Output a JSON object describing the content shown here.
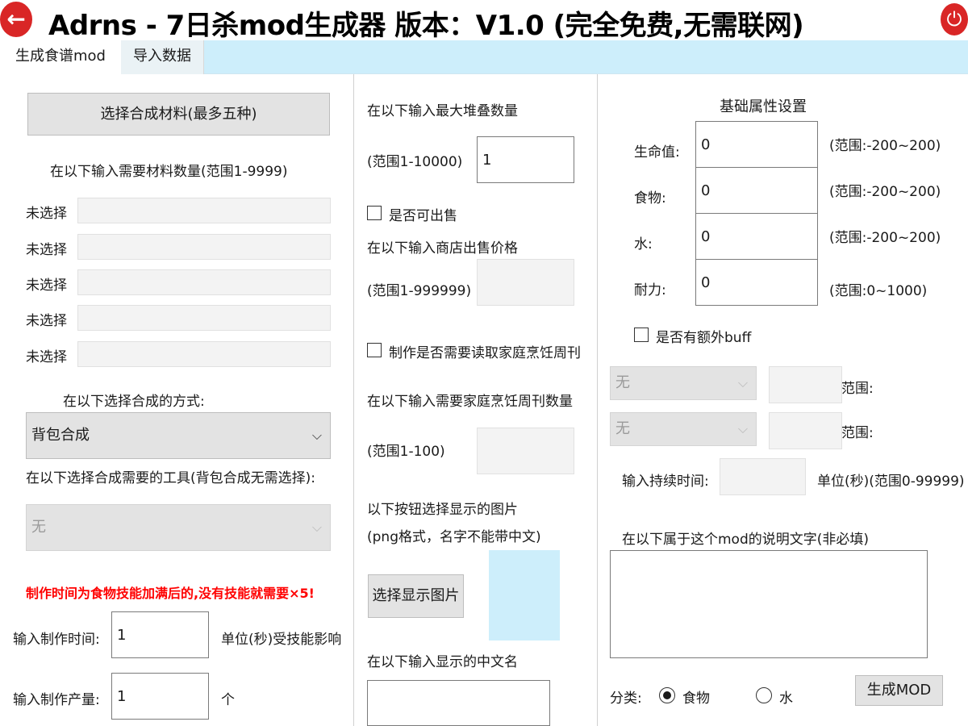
{
  "window": {
    "title": "Adrns - 7日杀mod生成器 版本：V1.0 (完全免费,无需联网)"
  },
  "tabs": [
    {
      "label": "生成食谱mod"
    },
    {
      "label": "导入数据"
    }
  ],
  "left": {
    "select_materials_button": "选择合成材料(最多五种)",
    "material_qty_label": "在以下输入需要材料数量(范围1-9999)",
    "materials": [
      {
        "label": "未选择",
        "value": ""
      },
      {
        "label": "未选择",
        "value": ""
      },
      {
        "label": "未选择",
        "value": ""
      },
      {
        "label": "未选择",
        "value": ""
      },
      {
        "label": "未选择",
        "value": ""
      }
    ],
    "craft_method_label": "在以下选择合成的方式:",
    "craft_method_value": "背包合成",
    "tool_label": "在以下选择合成需要的工具(背包合成无需选择):",
    "tool_value": "无",
    "warning": "制作时间为食物技能加满后的,没有技能就需要×5!",
    "craft_time_label": "输入制作时间:",
    "craft_time_value": "1",
    "craft_time_unit": "单位(秒)受技能影响",
    "craft_qty_label": "输入制作产量:",
    "craft_qty_value": "1",
    "craft_qty_unit": "个"
  },
  "middle": {
    "max_stack_label": "在以下输入最大堆叠数量",
    "max_stack_range": "(范围1-10000)",
    "max_stack_value": "1",
    "sellable_label": "是否可出售",
    "sell_price_label": "在以下输入商店出售价格",
    "sell_price_range": "(范围1-999999)",
    "sell_price_value": "",
    "need_magazine_label": "制作是否需要读取家庭烹饪周刊",
    "magazine_qty_label": "在以下输入需要家庭烹饪周刊数量",
    "magazine_qty_range": "(范围1-100)",
    "magazine_qty_value": "",
    "image_hint_line1": "以下按钮选择显示的图片",
    "image_hint_line2": "(png格式，名字不能带中文)",
    "select_image_button": "选择显示图片",
    "chinese_name_label": "在以下输入显示的中文名",
    "chinese_name_value": ""
  },
  "right": {
    "base_attrs_title": "基础属性设置",
    "attrs": [
      {
        "label": "生命值:",
        "value": "0",
        "range": "(范围:-200~200)"
      },
      {
        "label": "食物:",
        "value": "0",
        "range": "(范围:-200~200)"
      },
      {
        "label": "水:",
        "value": "0",
        "range": "(范围:-200~200)"
      },
      {
        "label": "耐力:",
        "value": "0",
        "range": "(范围:0~1000)"
      }
    ],
    "extra_buff_label": "是否有额外buff",
    "buffs": [
      {
        "select": "无",
        "value": "",
        "range_label": "范围:"
      },
      {
        "select": "无",
        "value": "",
        "range_label": "范围:"
      }
    ],
    "duration_label": "输入持续时间:",
    "duration_value": "",
    "duration_unit": "单位(秒)(范围0-99999)",
    "description_label": "在以下属于这个mod的说明文字(非必填)",
    "description_value": "",
    "category_label": "分类:",
    "category_food": "食物",
    "category_water": "水",
    "generate_button": "生成MOD"
  }
}
